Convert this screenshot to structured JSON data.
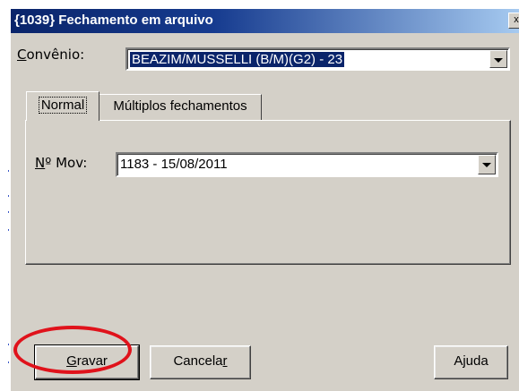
{
  "window": {
    "title": "{1039} Fechamento em arquivo",
    "close_glyph": "x"
  },
  "convenio": {
    "label_u": "C",
    "label_rest": "onvênio:",
    "value": "BEAZIM/MUSSELLI (B/M)(G2) - 23"
  },
  "tabs": [
    {
      "label": "Normal",
      "active": true
    },
    {
      "label": "Múltiplos fechamentos",
      "active": false
    }
  ],
  "mov": {
    "label_u": "N",
    "label_rest": "º Mov:",
    "value": "1183 - 15/08/2011"
  },
  "buttons": {
    "gravar_u": "G",
    "gravar_rest": "ravar",
    "cancelar_main": "Cancela",
    "cancelar_u": "r",
    "ajuda": "Ajuda"
  },
  "colors": {
    "titlebar": "#0a246a",
    "face": "#d4d0c8",
    "highlight_ring": "#e0121b"
  }
}
